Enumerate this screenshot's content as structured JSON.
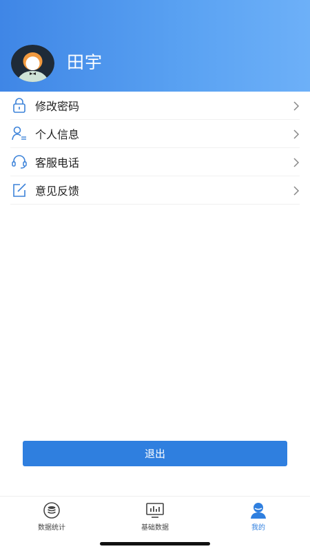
{
  "profile": {
    "name": "田宇"
  },
  "menu": [
    {
      "label": "修改密码",
      "icon": "lock-icon"
    },
    {
      "label": "个人信息",
      "icon": "user-info-icon"
    },
    {
      "label": "客服电话",
      "icon": "headset-icon"
    },
    {
      "label": "意见反馈",
      "icon": "edit-feedback-icon"
    }
  ],
  "logout": {
    "label": "退出"
  },
  "tabs": [
    {
      "label": "数据统计",
      "icon": "database-icon"
    },
    {
      "label": "基础数据",
      "icon": "monitor-chart-icon"
    },
    {
      "label": "我的",
      "icon": "profile-icon",
      "active": true
    }
  ],
  "colors": {
    "header_start": "#3f86e6",
    "header_end": "#6db0f8",
    "accent": "#2f7fdf"
  }
}
